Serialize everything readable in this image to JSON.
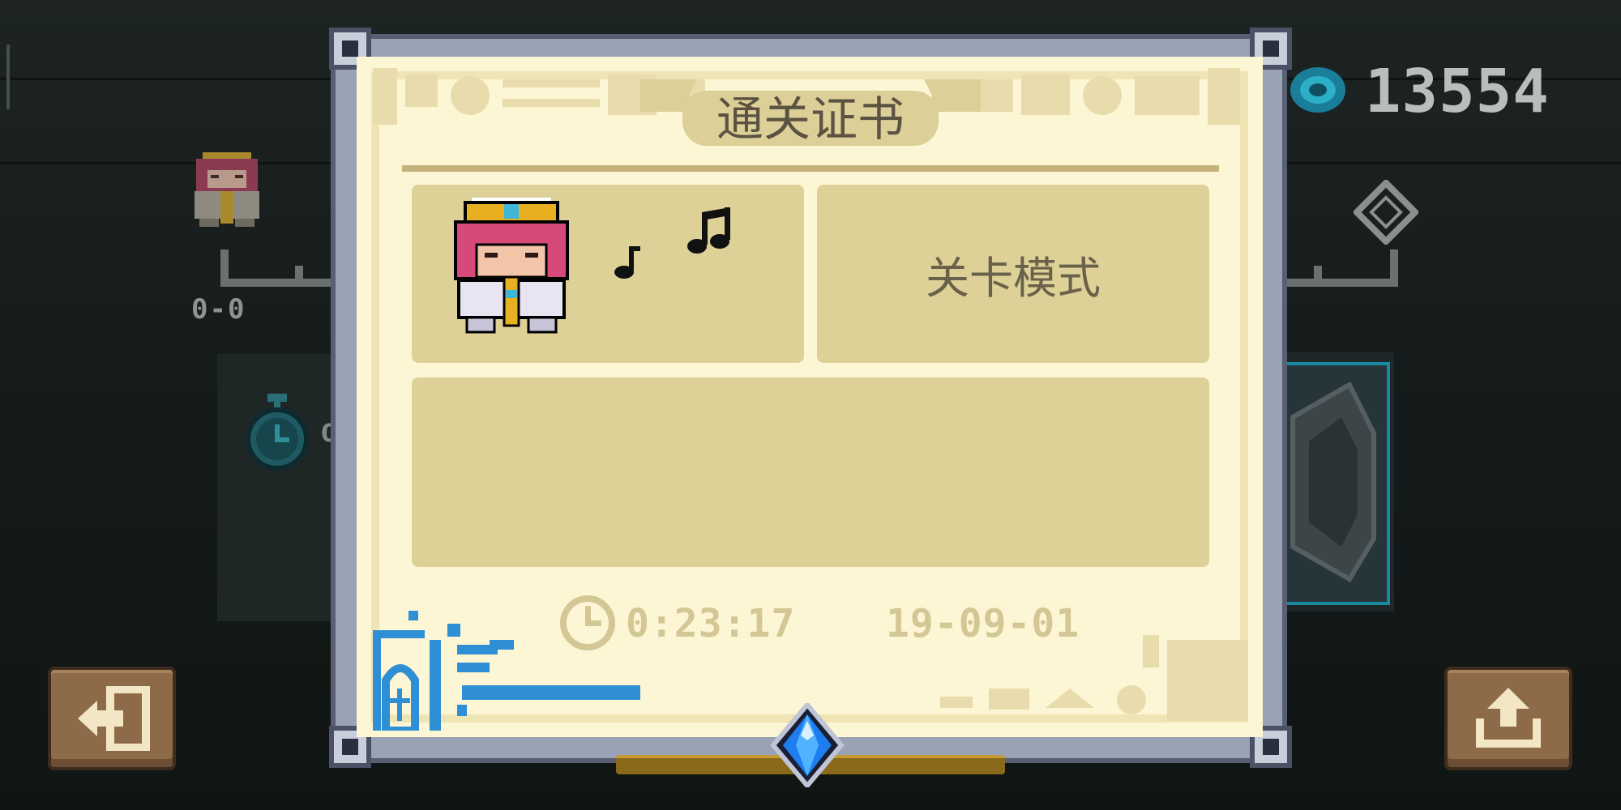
{
  "hud": {
    "coins": "13554",
    "score_left": "0-0",
    "timer_peek": "0"
  },
  "certificate": {
    "title": "通关证书",
    "mode": "关卡模式",
    "time": "0:23:17",
    "date": "19-09-01"
  },
  "buttons": {
    "exit_icon": "exit-icon",
    "share_icon": "share-icon"
  },
  "colors": {
    "paper": "#fdf6d4",
    "panel": "#ddd198",
    "stamp_blue": "#2e8fd4",
    "button_brown": "#8d6a48",
    "gem_blue": "#1e7ef0"
  }
}
